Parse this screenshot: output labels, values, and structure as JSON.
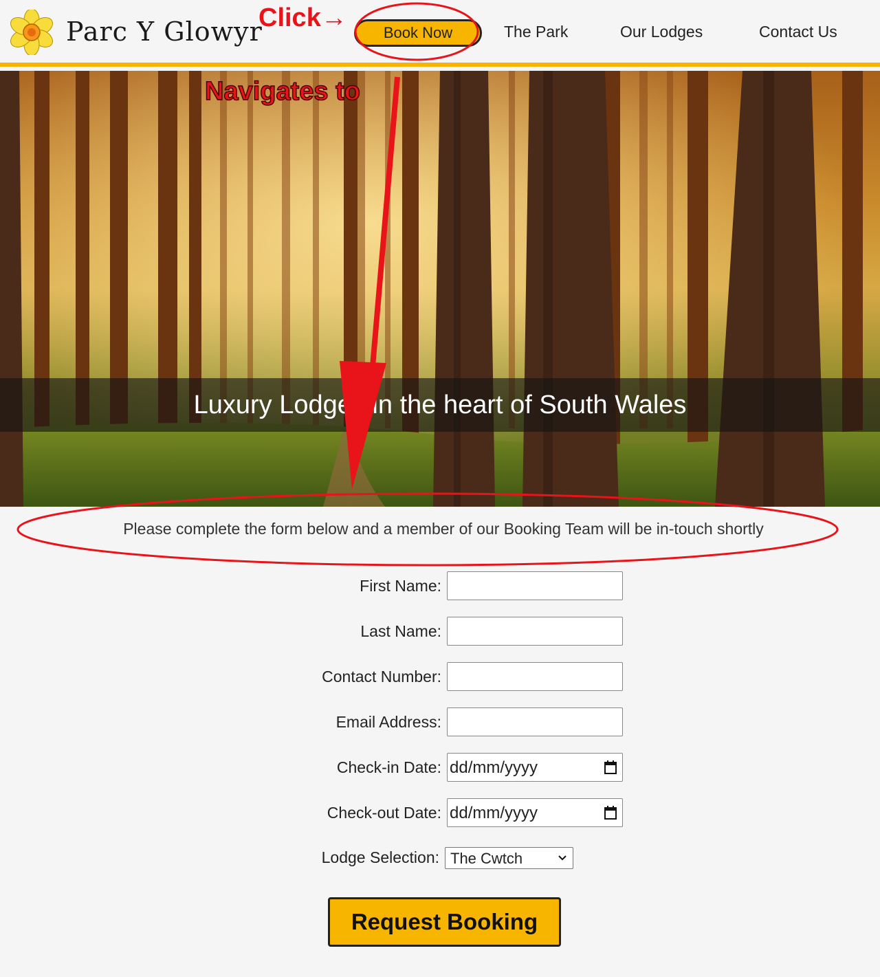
{
  "header": {
    "logo_text": "Parc Y Glowyr",
    "nav": {
      "book_now": "Book Now",
      "the_park": "The Park",
      "our_lodges": "Our Lodges",
      "contact_us": "Contact Us"
    },
    "accent_color": "#f7b500"
  },
  "hero": {
    "title": "Luxury Lodges in the heart of South Wales"
  },
  "form": {
    "intro": "Please complete the form below and a member of our Booking Team will be in-touch shortly",
    "first_name_label": "First Name:",
    "last_name_label": "Last Name:",
    "contact_number_label": "Contact Number:",
    "email_label": "Email Address:",
    "checkin_label": "Check-in Date:",
    "checkin_placeholder": "dd/mm/yyyy",
    "checkout_label": "Check-out Date:",
    "checkout_placeholder": "dd/mm/yyyy",
    "lodge_label": "Lodge Selection:",
    "lodge_selected": "The Cwtch",
    "submit_label": "Request Booking"
  },
  "annotations": {
    "click": "Click→",
    "navigates_to": "Navigates to",
    "color": "#e8141a"
  }
}
